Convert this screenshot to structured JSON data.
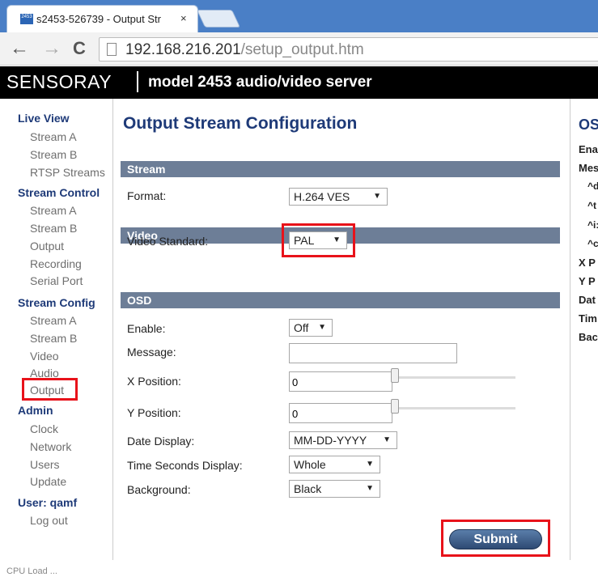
{
  "browser": {
    "tab_title": "s2453-526739 - Output Str",
    "tab_favicon_text": "2453",
    "tab_close": "×",
    "back": "←",
    "forward": "→",
    "reload": "C",
    "url_host": "192.168.216.201",
    "url_path": "/setup_output.htm"
  },
  "header": {
    "brand": "SENSORAY",
    "model": "model 2453 audio/video server"
  },
  "sidebar": {
    "live_view": "Live View",
    "live_view_items": [
      "Stream A",
      "Stream B",
      "RTSP Streams"
    ],
    "stream_control": "Stream Control",
    "stream_control_items": [
      "Stream A",
      "Stream B",
      "Output",
      "Recording",
      "Serial Port"
    ],
    "stream_config": "Stream Config",
    "stream_config_items": [
      "Stream A",
      "Stream B",
      "Video",
      "Audio",
      "Output"
    ],
    "admin": "Admin",
    "admin_items": [
      "Clock",
      "Network",
      "Users",
      "Update"
    ],
    "user": "User: qamf",
    "logout": "Log out"
  },
  "main": {
    "title": "Output Stream Configuration",
    "stream_section": "Stream",
    "format_label": "Format:",
    "format_value": "H.264 VES",
    "video_section": "Video",
    "video_standard_label": "Video Standard:",
    "video_standard_value": "PAL",
    "osd_section": "OSD",
    "enable_label": "Enable:",
    "enable_value": "Off",
    "message_label": "Message:",
    "message_value": "",
    "x_position_label": "X Position:",
    "x_position_value": "0",
    "y_position_label": "Y Position:",
    "y_position_value": "0",
    "date_display_label": "Date Display:",
    "date_display_value": "MM-DD-YYYY",
    "time_seconds_label": "Time Seconds Display:",
    "time_seconds_value": "Whole",
    "background_label": "Background:",
    "background_value": "Black",
    "submit": "Submit"
  },
  "right_panel": {
    "title": "OS",
    "items": [
      "Ena",
      "Mes",
      "X P",
      "Y P",
      "Dat",
      "Tim",
      "Bac"
    ],
    "sub_items": [
      "^d",
      "^t",
      "^i:",
      "^c"
    ]
  },
  "footer": "CPU Load ...",
  "colors": {
    "tabstrip": "#4a7fc6",
    "nav_heading": "#1e3a78",
    "section_bar": "#6d7e97",
    "highlight": "#e8121a"
  }
}
